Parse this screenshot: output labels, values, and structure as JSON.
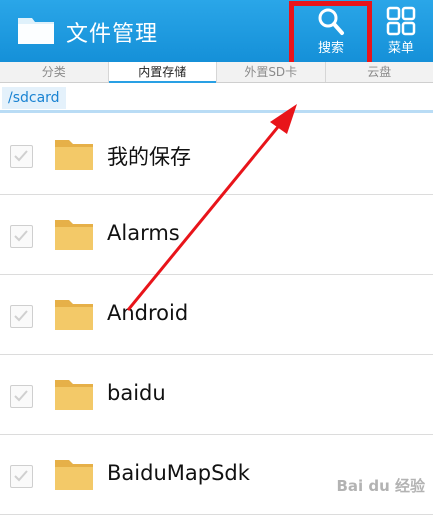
{
  "header": {
    "title": "文件管理",
    "search_label": "搜索",
    "menu_label": "菜单"
  },
  "tabs": [
    {
      "label": "分类"
    },
    {
      "label": "内置存储"
    },
    {
      "label": "外置SD卡"
    },
    {
      "label": "云盘"
    }
  ],
  "path": "/sdcard",
  "files": [
    {
      "name": "我的保存"
    },
    {
      "name": "Alarms"
    },
    {
      "name": "Android"
    },
    {
      "name": "baidu"
    },
    {
      "name": "BaiduMapSdk"
    }
  ],
  "watermark": "Bai du 经验",
  "colors": {
    "header": "#1b98de",
    "highlight": "#e8141a",
    "folder": "#f0c45d"
  }
}
